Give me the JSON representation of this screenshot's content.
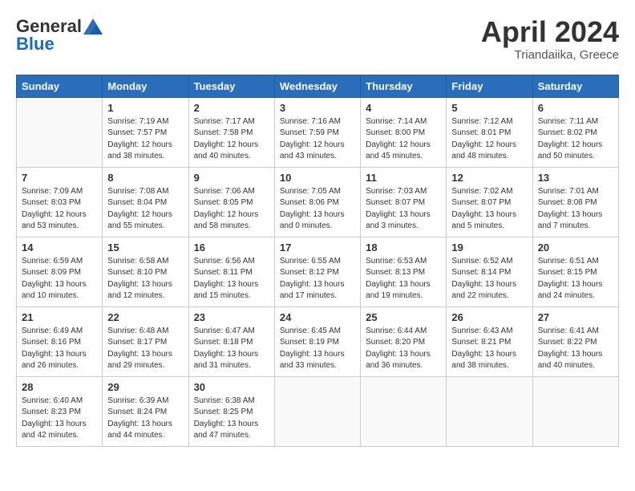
{
  "header": {
    "logo_general": "General",
    "logo_blue": "Blue",
    "month": "April 2024",
    "location": "Triandaiika, Greece"
  },
  "weekdays": [
    "Sunday",
    "Monday",
    "Tuesday",
    "Wednesday",
    "Thursday",
    "Friday",
    "Saturday"
  ],
  "weeks": [
    [
      {
        "day": "",
        "info": ""
      },
      {
        "day": "1",
        "info": "Sunrise: 7:19 AM\nSunset: 7:57 PM\nDaylight: 12 hours\nand 38 minutes."
      },
      {
        "day": "2",
        "info": "Sunrise: 7:17 AM\nSunset: 7:58 PM\nDaylight: 12 hours\nand 40 minutes."
      },
      {
        "day": "3",
        "info": "Sunrise: 7:16 AM\nSunset: 7:59 PM\nDaylight: 12 hours\nand 43 minutes."
      },
      {
        "day": "4",
        "info": "Sunrise: 7:14 AM\nSunset: 8:00 PM\nDaylight: 12 hours\nand 45 minutes."
      },
      {
        "day": "5",
        "info": "Sunrise: 7:12 AM\nSunset: 8:01 PM\nDaylight: 12 hours\nand 48 minutes."
      },
      {
        "day": "6",
        "info": "Sunrise: 7:11 AM\nSunset: 8:02 PM\nDaylight: 12 hours\nand 50 minutes."
      }
    ],
    [
      {
        "day": "7",
        "info": "Sunrise: 7:09 AM\nSunset: 8:03 PM\nDaylight: 12 hours\nand 53 minutes."
      },
      {
        "day": "8",
        "info": "Sunrise: 7:08 AM\nSunset: 8:04 PM\nDaylight: 12 hours\nand 55 minutes."
      },
      {
        "day": "9",
        "info": "Sunrise: 7:06 AM\nSunset: 8:05 PM\nDaylight: 12 hours\nand 58 minutes."
      },
      {
        "day": "10",
        "info": "Sunrise: 7:05 AM\nSunset: 8:06 PM\nDaylight: 13 hours\nand 0 minutes."
      },
      {
        "day": "11",
        "info": "Sunrise: 7:03 AM\nSunset: 8:07 PM\nDaylight: 13 hours\nand 3 minutes."
      },
      {
        "day": "12",
        "info": "Sunrise: 7:02 AM\nSunset: 8:07 PM\nDaylight: 13 hours\nand 5 minutes."
      },
      {
        "day": "13",
        "info": "Sunrise: 7:01 AM\nSunset: 8:08 PM\nDaylight: 13 hours\nand 7 minutes."
      }
    ],
    [
      {
        "day": "14",
        "info": "Sunrise: 6:59 AM\nSunset: 8:09 PM\nDaylight: 13 hours\nand 10 minutes."
      },
      {
        "day": "15",
        "info": "Sunrise: 6:58 AM\nSunset: 8:10 PM\nDaylight: 13 hours\nand 12 minutes."
      },
      {
        "day": "16",
        "info": "Sunrise: 6:56 AM\nSunset: 8:11 PM\nDaylight: 13 hours\nand 15 minutes."
      },
      {
        "day": "17",
        "info": "Sunrise: 6:55 AM\nSunset: 8:12 PM\nDaylight: 13 hours\nand 17 minutes."
      },
      {
        "day": "18",
        "info": "Sunrise: 6:53 AM\nSunset: 8:13 PM\nDaylight: 13 hours\nand 19 minutes."
      },
      {
        "day": "19",
        "info": "Sunrise: 6:52 AM\nSunset: 8:14 PM\nDaylight: 13 hours\nand 22 minutes."
      },
      {
        "day": "20",
        "info": "Sunrise: 6:51 AM\nSunset: 8:15 PM\nDaylight: 13 hours\nand 24 minutes."
      }
    ],
    [
      {
        "day": "21",
        "info": "Sunrise: 6:49 AM\nSunset: 8:16 PM\nDaylight: 13 hours\nand 26 minutes."
      },
      {
        "day": "22",
        "info": "Sunrise: 6:48 AM\nSunset: 8:17 PM\nDaylight: 13 hours\nand 29 minutes."
      },
      {
        "day": "23",
        "info": "Sunrise: 6:47 AM\nSunset: 8:18 PM\nDaylight: 13 hours\nand 31 minutes."
      },
      {
        "day": "24",
        "info": "Sunrise: 6:45 AM\nSunset: 8:19 PM\nDaylight: 13 hours\nand 33 minutes."
      },
      {
        "day": "25",
        "info": "Sunrise: 6:44 AM\nSunset: 8:20 PM\nDaylight: 13 hours\nand 36 minutes."
      },
      {
        "day": "26",
        "info": "Sunrise: 6:43 AM\nSunset: 8:21 PM\nDaylight: 13 hours\nand 38 minutes."
      },
      {
        "day": "27",
        "info": "Sunrise: 6:41 AM\nSunset: 8:22 PM\nDaylight: 13 hours\nand 40 minutes."
      }
    ],
    [
      {
        "day": "28",
        "info": "Sunrise: 6:40 AM\nSunset: 8:23 PM\nDaylight: 13 hours\nand 42 minutes."
      },
      {
        "day": "29",
        "info": "Sunrise: 6:39 AM\nSunset: 8:24 PM\nDaylight: 13 hours\nand 44 minutes."
      },
      {
        "day": "30",
        "info": "Sunrise: 6:38 AM\nSunset: 8:25 PM\nDaylight: 13 hours\nand 47 minutes."
      },
      {
        "day": "",
        "info": ""
      },
      {
        "day": "",
        "info": ""
      },
      {
        "day": "",
        "info": ""
      },
      {
        "day": "",
        "info": ""
      }
    ]
  ]
}
